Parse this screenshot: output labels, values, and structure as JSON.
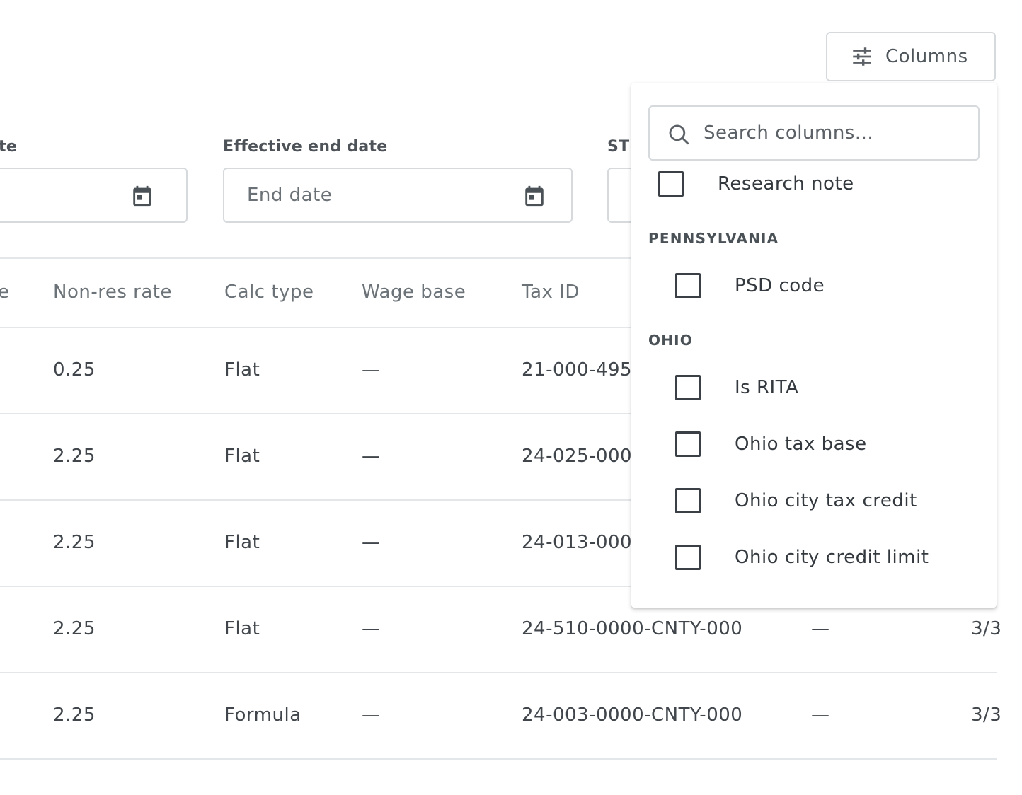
{
  "toolbar": {
    "columns_label": "Columns"
  },
  "filters": {
    "start_label_partial": "te",
    "end_label": "Effective end date",
    "end_placeholder": "End date",
    "third_label_partial": "ST"
  },
  "table": {
    "headers": {
      "partial": "e",
      "nonres": "Non-res rate",
      "calc": "Calc type",
      "wage": "Wage base",
      "taxid": "Tax ID"
    },
    "rows": [
      {
        "rate": "0.25",
        "calc": "Flat",
        "wage": "—",
        "taxid": "21-000-495",
        "extra": "",
        "date": ""
      },
      {
        "rate": "2.25",
        "calc": "Flat",
        "wage": "—",
        "taxid": "24-025-000",
        "extra": "",
        "date": ""
      },
      {
        "rate": "2.25",
        "calc": "Flat",
        "wage": "—",
        "taxid": "24-013-000",
        "extra": "",
        "date": ""
      },
      {
        "rate": "2.25",
        "calc": "Flat",
        "wage": "—",
        "taxid": "24-510-0000-CNTY-000",
        "extra": "—",
        "date": "3/3"
      },
      {
        "rate": "2.25",
        "calc": "Formula",
        "wage": "—",
        "taxid": "24-003-0000-CNTY-000",
        "extra": "—",
        "date": "3/3"
      }
    ]
  },
  "columns_menu": {
    "search_placeholder": "Search columns...",
    "items_top": [
      {
        "label": "Research note",
        "checked": false
      }
    ],
    "groups": [
      {
        "title": "PENNSYLVANIA",
        "items": [
          {
            "label": "PSD code",
            "checked": false
          }
        ]
      },
      {
        "title": "OHIO",
        "items": [
          {
            "label": "Is RITA",
            "checked": false
          },
          {
            "label": "Ohio tax base",
            "checked": false
          },
          {
            "label": "Ohio city tax credit",
            "checked": false
          },
          {
            "label": "Ohio city credit limit",
            "checked": false
          }
        ]
      }
    ]
  }
}
